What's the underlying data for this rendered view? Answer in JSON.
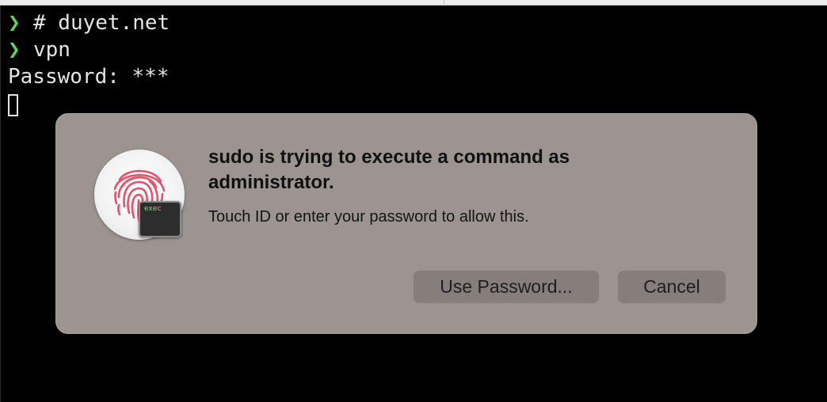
{
  "terminal": {
    "prompt_symbol": "❯",
    "lines": [
      "# duyet.net",
      "vpn"
    ],
    "password_line": "Password: ***"
  },
  "dialog": {
    "title": "sudo is trying to execute a command as administrator.",
    "message": "Touch ID or enter your password to allow this.",
    "icon": "fingerprint-icon",
    "badge_label": "exec",
    "buttons": {
      "use_password": "Use Password...",
      "cancel": "Cancel"
    }
  },
  "colors": {
    "prompt": "#5fd35f",
    "dialog_bg": "#9b9491",
    "button_bg": "#867e7b",
    "fingerprint": "#e8506a"
  }
}
